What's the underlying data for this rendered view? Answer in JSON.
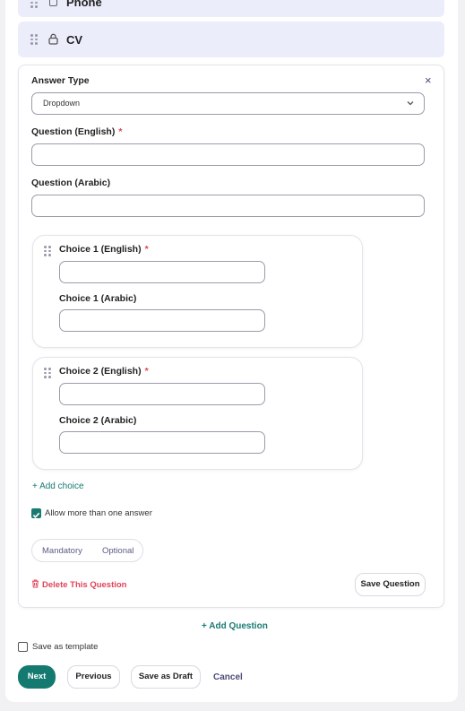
{
  "fields": {
    "phone_label": "Phone",
    "cv_label": "CV"
  },
  "question": {
    "close_symbol": "×",
    "answer_type_label": "Answer Type",
    "answer_type_value": "Dropdown",
    "question_en_label": "Question (English)",
    "question_ar_label": "Question (Arabic)",
    "required_mark": "*",
    "choices": [
      {
        "en_label": "Choice 1 (English)",
        "ar_label": "Choice 1 (Arabic)"
      },
      {
        "en_label": "Choice 2 (English)",
        "ar_label": "Choice 2 (Arabic)"
      }
    ],
    "add_choice": "+ Add choice",
    "allow_multiple": "Allow more than one answer",
    "allow_multiple_checked": true,
    "mandatory": "Mandatory",
    "optional": "Optional",
    "delete": "Delete This Question",
    "save_question": "Save Question"
  },
  "footer": {
    "add_question": "+ Add Question",
    "save_template": "Save as template",
    "next": "Next",
    "previous": "Previous",
    "save_draft": "Save as Draft",
    "cancel": "Cancel"
  },
  "colors": {
    "accent": "#147a70",
    "danger": "#e0445a",
    "row_bg": "#ecedfb"
  }
}
